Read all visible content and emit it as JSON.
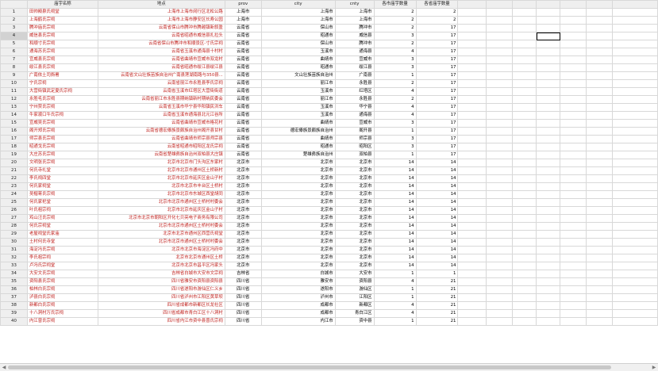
{
  "columns": [
    "",
    "庙宇名称",
    "地点",
    "prov",
    "city",
    "cnty",
    "各市庙宇数量",
    "各省庙宇数量",
    "",
    "",
    "",
    "",
    "",
    "",
    ""
  ],
  "selected_row": 4,
  "selected_col": 11,
  "rows": [
    [
      "1",
      "田帅殿泉氏祠堂",
      "上海市上海市闵行区北松公路",
      "上海市",
      "上海市",
      "上海市",
      "2",
      "2"
    ],
    [
      "2",
      "上海鹤氏宗祠",
      "上海市上海市静安区长寿公园",
      "上海市",
      "上海市",
      "上海市",
      "2",
      "2"
    ],
    [
      "3",
      "腾冲庙氏宗祠",
      "云南省保山市腾冲市腾越镇新叙盈",
      "云南省",
      "保山市",
      "腾冲市",
      "2",
      "17"
    ],
    [
      "4",
      "威信县氏宗祠",
      "云南省昭通市威信县扎拉头",
      "云南省",
      "昭通市",
      "威信县",
      "3",
      "17"
    ],
    [
      "5",
      "和顺寸氏宗祠",
      "云南省保山市腾冲市和顺景区-寸氏宗祠",
      "云南省",
      "保山市",
      "腾冲市",
      "2",
      "17"
    ],
    [
      "6",
      "通海苏氏宗祠",
      "云南省玉溪市通海县十村村",
      "云南省",
      "玉溪市",
      "通海县",
      "4",
      "17"
    ],
    [
      "7",
      "宣威县氏宗祠",
      "云南省曲靖市宣威市双龙村",
      "云南省",
      "曲靖市",
      "宣威市",
      "3",
      "17"
    ],
    [
      "8",
      "绥江县氏宗祠",
      "云南省昭通市绥江县绥江县",
      "云南省",
      "昭通市",
      "绥江县",
      "3",
      "17"
    ],
    [
      "9",
      "广南依土司衙署",
      "云南省文山壮族苗族自治州广南县莲湖南路与350县...",
      "云南省",
      "文山壮族苗族自治州",
      "广南县",
      "1",
      "17"
    ],
    [
      "10",
      "宁氏宗祠",
      "云南省丽江市永胜县李氏宗祠",
      "云南省",
      "丽江市",
      "永胜县",
      "2",
      "17"
    ],
    [
      "11",
      "大营街镇武定夏氏宗祠",
      "云南省玉溪市红塔区大营街街道",
      "云南省",
      "玉溪市",
      "红塔区",
      "4",
      "17"
    ],
    [
      "12",
      "永胜毛氏宗祠",
      "云南省丽江市永胜县期纳镇新村期纳民委会",
      "云南省",
      "丽江市",
      "永胜县",
      "2",
      "17"
    ],
    [
      "13",
      "宁州贾氏宗祠",
      "云南省玉溪市华宁县华阳镇民洪车",
      "云南省",
      "玉溪市",
      "华宁县",
      "4",
      "17"
    ],
    [
      "14",
      "牛家渡口牛氏宗祠",
      "云南省玉溪市通海县北元江谷所",
      "云南省",
      "玉溪市",
      "通海县",
      "4",
      "17"
    ],
    [
      "15",
      "宣威吴氏宗祠",
      "云南省曲靖市宣威市格花村",
      "云南省",
      "曲靖市",
      "宣威市",
      "3",
      "17"
    ],
    [
      "16",
      "阁开郑氏宗祠",
      "云南省德宏傣族景颇族自治州阁开县甘村",
      "云南省",
      "德宏傣族景颇族自治州",
      "阁开县",
      "1",
      "17"
    ],
    [
      "17",
      "师宗县氏宗祠",
      "云南省曲靖市师宗县师宗县",
      "云南省",
      "曲靖市",
      "师宗县",
      "3",
      "17"
    ],
    [
      "18",
      "昭通戈氏宗祠",
      "云南省昭通市昭阳区龙氏宗祠",
      "云南省",
      "昭通市",
      "昭阳区",
      "3",
      "17"
    ],
    [
      "19",
      "大庄苏氏宗祠",
      "云南省楚雄彝族自治州双柏县大庄镇",
      "云南省",
      "楚雄彝族自治州",
      "双柏县",
      "1",
      "17"
    ],
    [
      "20",
      "文明张氏宗祠",
      "北京市北京市门头沟区东家村",
      "北京市",
      "北京市",
      "北京市",
      "14",
      "14"
    ],
    [
      "21",
      "何氏寺礼堂",
      "北京市北京市通州区土桥新村",
      "北京市",
      "北京市",
      "北京市",
      "14",
      "14"
    ],
    [
      "22",
      "李氏祠四堂",
      "北京市北京市延庆区金山子村",
      "北京市",
      "北京市",
      "北京市",
      "14",
      "14"
    ],
    [
      "23",
      "何氏家祠堂",
      "北京市北京市丰台区土桥村",
      "北京市",
      "北京市",
      "北京市",
      "14",
      "14"
    ],
    [
      "24",
      "吴楷蒋氏宗祠",
      "北京市北京市东城区西堂胡同",
      "北京市",
      "北京市",
      "北京市",
      "14",
      "14"
    ],
    [
      "25",
      "何氏家祀堂",
      "北京市北京市通州区土桥村村委会",
      "北京市",
      "北京市",
      "北京市",
      "14",
      "14"
    ],
    [
      "26",
      "叶氏祖宗祠",
      "北京市北京市延庆区金山子村",
      "北京市",
      "北京市",
      "北京市",
      "14",
      "14"
    ],
    [
      "27",
      "鸡山汪氏宗祠",
      "北京市北京市朝阳区开化七贝亮电子商务有限公司",
      "北京市",
      "北京市",
      "北京市",
      "14",
      "14"
    ],
    [
      "28",
      "何氏宗祠堂",
      "北京市北京市通州区土桥村村委会",
      "北京市",
      "北京市",
      "北京市",
      "14",
      "14"
    ],
    [
      "29",
      "老屋祠堂氏家庙",
      "北京市北京市通州区西营氏祠堂",
      "北京市",
      "北京市",
      "北京市",
      "14",
      "14"
    ],
    [
      "30",
      "土村何氏寺堂",
      "北京市北京市通州区土桥村村委会",
      "北京市",
      "北京市",
      "北京市",
      "14",
      "14"
    ],
    [
      "31",
      "海淀冯氏宗祠",
      "北京市北京市海淀区冯府中",
      "北京市",
      "北京市",
      "北京市",
      "14",
      "14"
    ],
    [
      "32",
      "李氏祖宗祠",
      "北京市北京市通州区土桥",
      "北京市",
      "北京市",
      "北京市",
      "14",
      "14"
    ],
    [
      "33",
      "卢冯氏宗祠堂",
      "北京市北京市昌平区冯家头",
      "北京市",
      "北京市",
      "北京市",
      "14",
      "14"
    ],
    [
      "34",
      "大安文氏宗祠",
      "吉林省白城市大安市文宗祠",
      "吉林省",
      "白城市",
      "大安市",
      "1",
      "1"
    ],
    [
      "35",
      "资阳县氏宗祠",
      "四川省雅安市资阳县资阳县",
      "四川省",
      "雅安市",
      "资阳县",
      "4",
      "21"
    ],
    [
      "36",
      "柏林白氏宗祠",
      "四川省遂阳市游仙区仁义乡",
      "四川省",
      "遂阳市",
      "游仙区",
      "1",
      "21"
    ],
    [
      "37",
      "泸县白氏宗祠",
      "四川省泸州市江阳区黄草坝",
      "四川省",
      "泸州市",
      "江阳区",
      "1",
      "21"
    ],
    [
      "38",
      "新都白氏宗祠",
      "四川省成都市新都区长龙社区",
      "四川省",
      "成都市",
      "新都区",
      "4",
      "21"
    ],
    [
      "39",
      "十八洞村万氏宗祠",
      "四川省成都市青白江区十八洞村",
      "四川省",
      "成都市",
      "青白江区",
      "4",
      "21"
    ],
    [
      "40",
      "内江曾氏宗祠",
      "四川省内江市资中县曾氏宗祠",
      "四川省",
      "内江市",
      "资中县",
      "1",
      "21"
    ]
  ]
}
